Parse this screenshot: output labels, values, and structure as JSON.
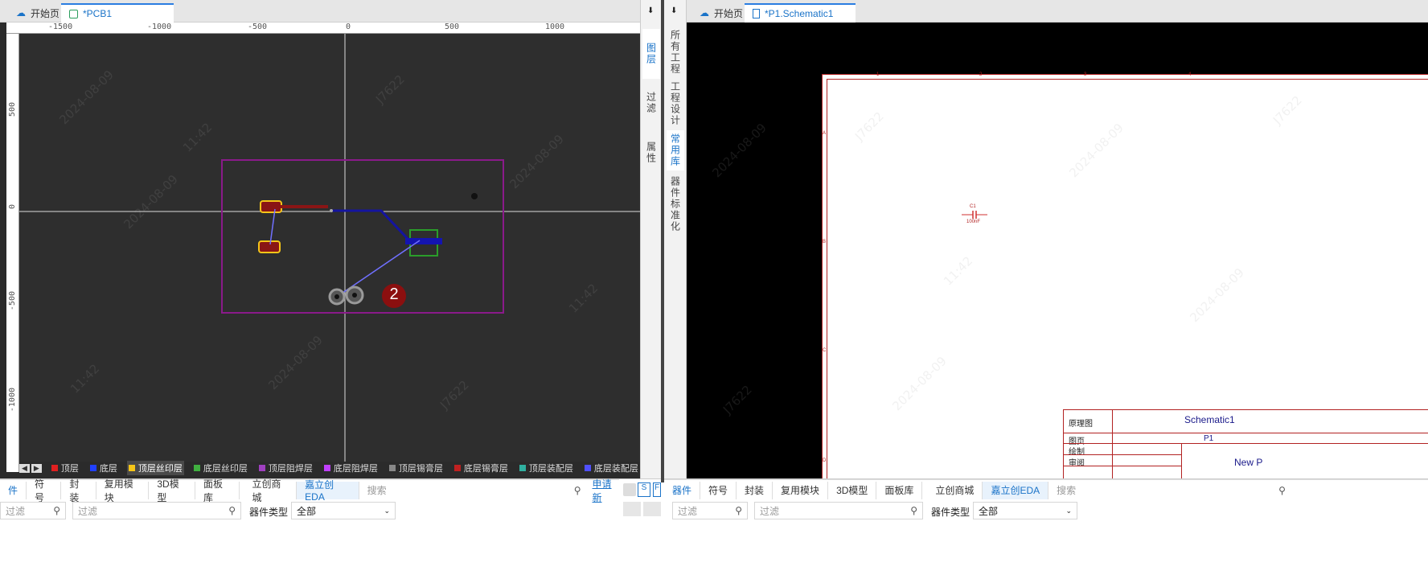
{
  "left_panel": {
    "tabs": [
      {
        "label": "开始页",
        "icon": "cloud-icon"
      },
      {
        "label": "*PCB1",
        "icon": "pcb-file-icon",
        "active": true
      }
    ],
    "ruler_x": [
      "-1500",
      "-1000",
      "-500",
      "0",
      "500",
      "1000"
    ],
    "ruler_y": [
      "500",
      "0",
      "-500",
      "-1000"
    ],
    "canvas_badge": "2",
    "layers": [
      {
        "label": "顶层",
        "color": "#e02020"
      },
      {
        "label": "底层",
        "color": "#2040ff"
      },
      {
        "label": "顶层丝印层",
        "color": "#f5c518",
        "active": true
      },
      {
        "label": "底层丝印层",
        "color": "#40b040"
      },
      {
        "label": "顶层阻焊层",
        "color": "#a040c0"
      },
      {
        "label": "底层阻焊层",
        "color": "#c040ff"
      },
      {
        "label": "顶层锡膏层",
        "color": "#888888"
      },
      {
        "label": "底层锡膏层",
        "color": "#c02020"
      },
      {
        "label": "顶层装配层",
        "color": "#30b0a0"
      },
      {
        "label": "底层装配层",
        "color": "#5050ff"
      }
    ]
  },
  "side_tabs": [
    "图层",
    "过滤",
    "属性"
  ],
  "right_side_tabs": [
    "所有工程",
    "工程设计",
    "常用库",
    "器件标准化"
  ],
  "right_panel": {
    "tabs": [
      {
        "label": "开始页",
        "icon": "cloud-icon"
      },
      {
        "label": "*P1.Schematic1",
        "icon": "schematic-file-icon",
        "active": true
      }
    ],
    "frame_cols": [
      "1",
      "2",
      "3",
      "4"
    ],
    "frame_rows": [
      "A",
      "B",
      "C",
      "D"
    ],
    "component": {
      "ref": "C1",
      "value": "100nF"
    },
    "title_block": {
      "type_label": "原理图",
      "sheet_name": "Schematic1",
      "page_label": "图页",
      "page_value": "P1",
      "drawn_label": "绘制",
      "review_label": "审阅",
      "project": "New P"
    }
  },
  "bottom_left": {
    "tabs": [
      "件",
      "符号",
      "封装",
      "复用模块",
      "3D模型",
      "面板库",
      "立创商城",
      "嘉立创EDA",
      "搜索"
    ],
    "link": "申请新",
    "filter_placeholder": "过滤",
    "filter2_placeholder": "过滤",
    "type_label": "器件类型",
    "type_value": "全部",
    "toggle_s": "S",
    "toggle_f": "F"
  },
  "bottom_right": {
    "tabs": [
      "器件",
      "符号",
      "封装",
      "复用模块",
      "3D模型",
      "面板库",
      "立创商城",
      "嘉立创EDA",
      "搜索"
    ],
    "filter_placeholder": "过滤",
    "filter2_placeholder": "过滤",
    "type_label": "器件类型",
    "type_value": "全部"
  },
  "watermark": {
    "date": "2024-08-09",
    "time": "11:42",
    "user": "J7622"
  },
  "colors": {
    "accent": "#1a73c8",
    "pcb_bg": "#2b2b2b",
    "board_outline": "#8a1a8a",
    "sch_frame": "#b22222"
  }
}
